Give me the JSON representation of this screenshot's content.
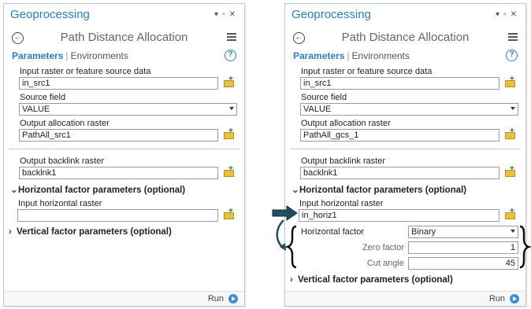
{
  "left": {
    "title": "Geoprocessing",
    "tool_title": "Path Distance Allocation",
    "tab_parameters": "Parameters",
    "tab_separator": "|",
    "tab_environments": "Environments",
    "input_raster_label": "Input raster or feature source data",
    "input_raster_value": "in_src1",
    "source_field_label": "Source field",
    "source_field_value": "VALUE",
    "output_allocation_label": "Output allocation raster",
    "output_allocation_value": "PathAll_src1",
    "output_backlink_label": "Output backlink raster",
    "output_backlink_value": "backlnk1",
    "horizontal_group": "Horizontal factor parameters (optional)",
    "input_horizontal_label": "Input horizontal raster",
    "input_horizontal_value": "",
    "vertical_group": "Vertical factor parameters (optional)",
    "run_label": "Run"
  },
  "right": {
    "title": "Geoprocessing",
    "tool_title": "Path Distance Allocation",
    "tab_parameters": "Parameters",
    "tab_separator": "|",
    "tab_environments": "Environments",
    "input_raster_label": "Input raster or feature source data",
    "input_raster_value": "in_src1",
    "source_field_label": "Source field",
    "source_field_value": "VALUE",
    "output_allocation_label": "Output allocation raster",
    "output_allocation_value": "PathAll_gcs_1",
    "output_backlink_label": "Output backlink raster",
    "output_backlink_value": "backlnk1",
    "horizontal_group": "Horizontal factor parameters (optional)",
    "input_horizontal_label": "Input horizontal raster",
    "input_horizontal_value": "in_horiz1",
    "horizontal_factor_label": "Horizontal factor",
    "horizontal_factor_value": "Binary",
    "zero_factor_label": "Zero factor",
    "zero_factor_value": "1",
    "cut_angle_label": "Cut angle",
    "cut_angle_value": "45",
    "vertical_group": "Vertical factor parameters (optional)",
    "run_label": "Run"
  },
  "colors": {
    "accent": "#2a7fc1",
    "annotation_arrow": "#1f4e63"
  }
}
